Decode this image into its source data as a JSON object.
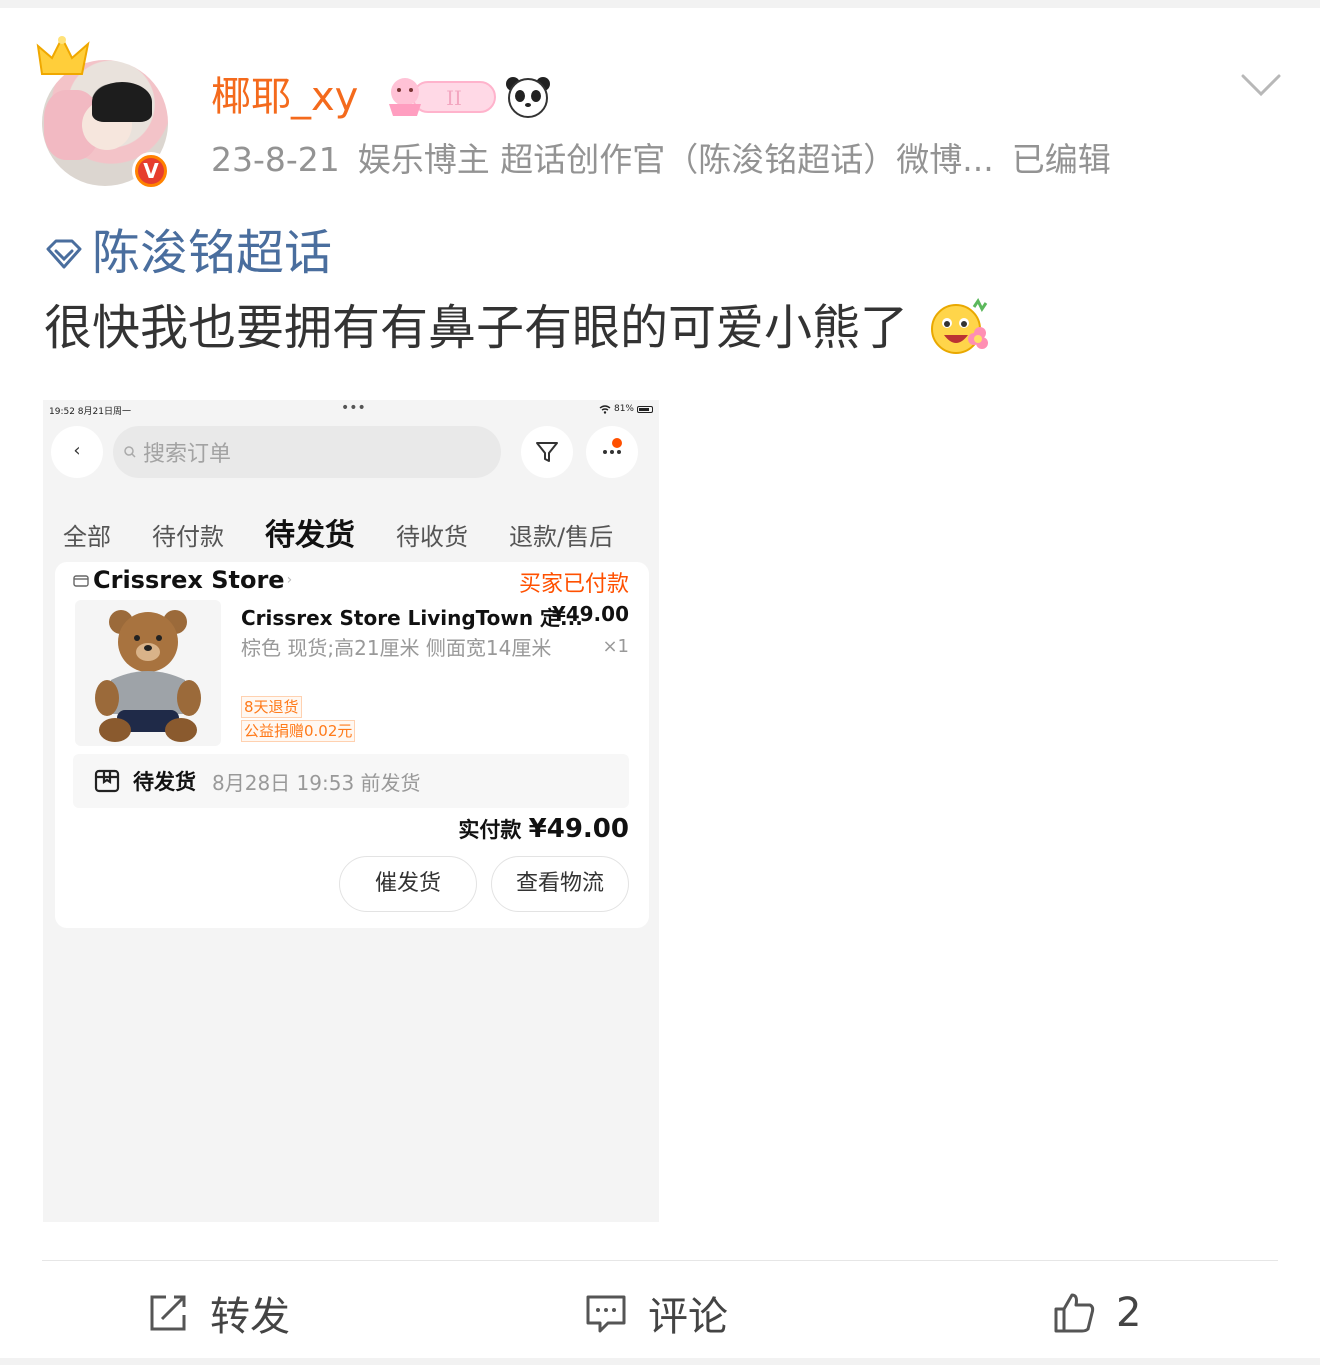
{
  "post": {
    "username": "椰耶_xy",
    "meta": {
      "date": "23-8-21",
      "tags": "娱乐博主 超话创作官（陈浚铭超话）微博...",
      "edited": "已编辑"
    },
    "topic": "陈浚铭超话",
    "text": "很快我也要拥有有鼻子有眼的可爱小熊了",
    "verified_badge": "V"
  },
  "screenshot": {
    "status_time": "19:52  8月21日周一",
    "status_battery": "81%",
    "search_placeholder": "搜索订单",
    "tabs": [
      {
        "label": "全部",
        "active": false
      },
      {
        "label": "待付款",
        "active": false
      },
      {
        "label": "待发货",
        "active": true
      },
      {
        "label": "待收货",
        "active": false
      },
      {
        "label": "退款/售后",
        "active": false
      }
    ],
    "order": {
      "store": "Crissrex Store",
      "status": "买家已付款",
      "product_title": "Crissrex Store LivingTown 定...",
      "price": "¥49.00",
      "spec": "棕色 现货;高21厘米 侧面宽14厘米",
      "qty": "×1",
      "tag1": "8天退货",
      "tag2": "公益捐赠0.02元",
      "ship_label": "待发货",
      "ship_time": "8月28日 19:53 前发货",
      "paid_label": "实付款",
      "paid_amount": "¥49.00",
      "btn_remind": "催发货",
      "btn_logistics": "查看物流"
    }
  },
  "actions": {
    "repost": "转发",
    "comment": "评论",
    "like_count": "2"
  },
  "colors": {
    "username": "#f46a1c",
    "topic": "#4a6e9e",
    "taobao_orange": "#ff5000"
  }
}
